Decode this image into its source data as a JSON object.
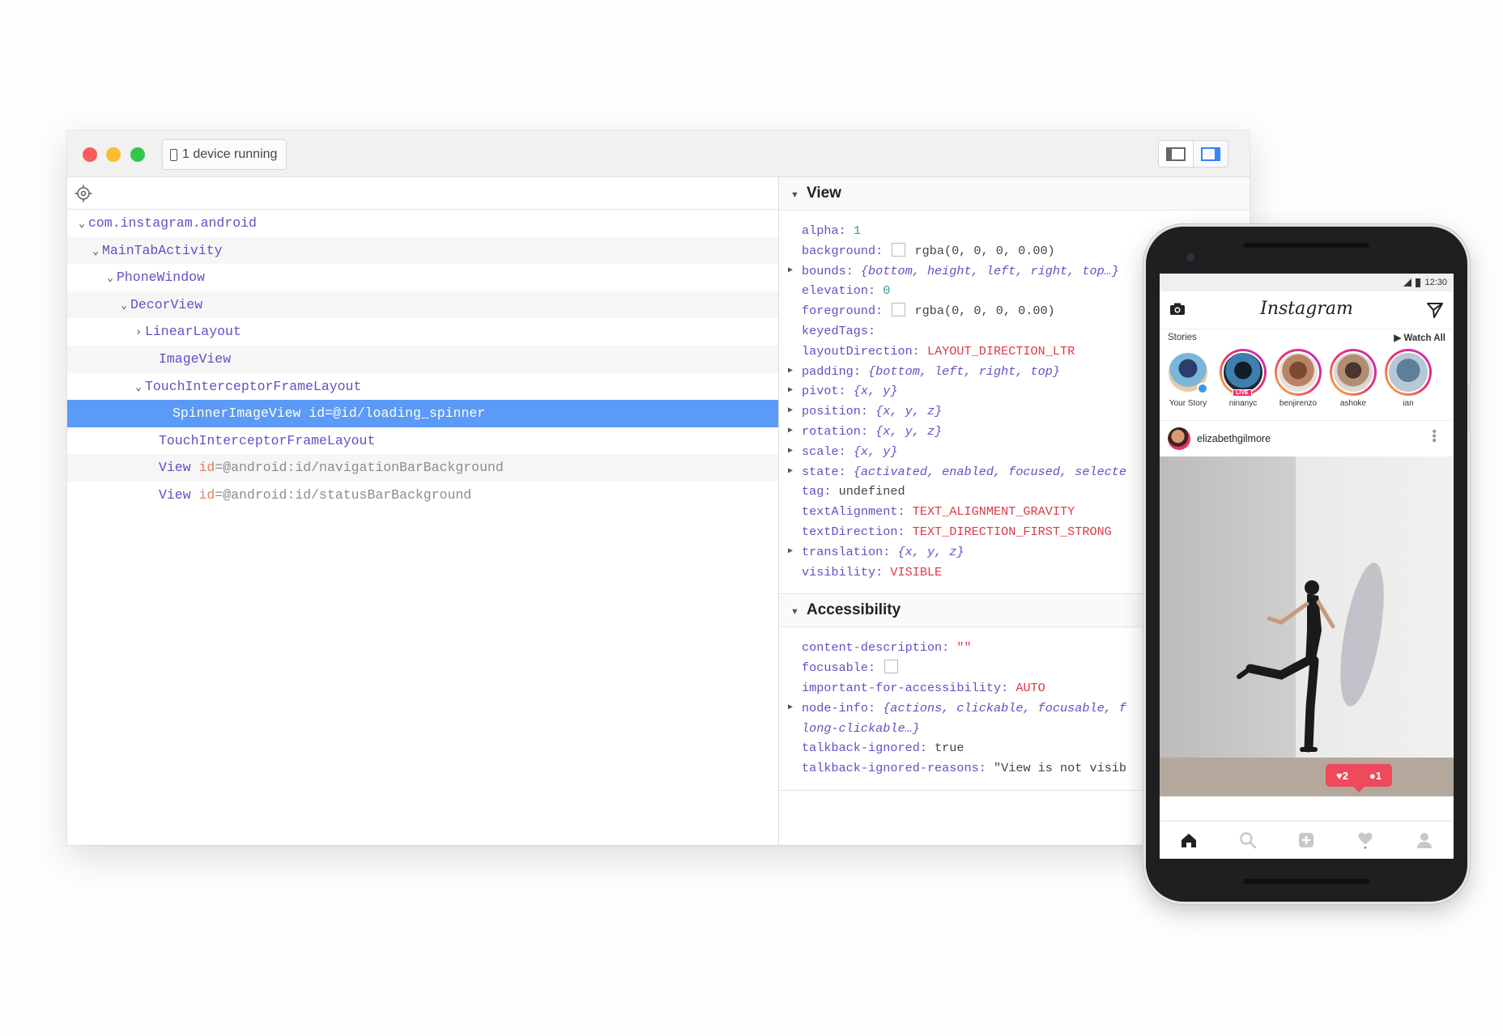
{
  "window": {
    "device_status": "1 device running"
  },
  "tree": {
    "rows": [
      {
        "label": "com.instagram.android",
        "chev": "⌄"
      },
      {
        "label": "MainTabActivity",
        "chev": "⌄"
      },
      {
        "label": "PhoneWindow",
        "chev": "⌄"
      },
      {
        "label": "DecorView",
        "chev": "⌄"
      },
      {
        "label": "LinearLayout",
        "chev": "›"
      },
      {
        "label": "ImageView",
        "chev": ""
      },
      {
        "label": "TouchInterceptorFrameLayout",
        "chev": "⌄"
      },
      {
        "label": "SpinnerImageView id=@id/loading_spinner",
        "chev": ""
      },
      {
        "label": "TouchInterceptorFrameLayout",
        "chev": ""
      },
      {
        "label": "View",
        "attr_key": "id",
        "attr_val": "=@android:id/navigationBarBackground",
        "chev": ""
      },
      {
        "label": "View",
        "attr_key": "id",
        "attr_val": "=@android:id/statusBarBackground",
        "chev": ""
      }
    ]
  },
  "view_section": {
    "title": "View",
    "props": [
      {
        "key": "alpha",
        "value": "1",
        "style": "num"
      },
      {
        "key": "background",
        "value": "rgba(0, 0, 0, 0.00)",
        "style": "plain",
        "swatch": true
      },
      {
        "key": "bounds",
        "value": "{bottom, height, left, right, top…}",
        "style": "it",
        "expandable": true
      },
      {
        "key": "elevation",
        "value": "0",
        "style": "num"
      },
      {
        "key": "foreground",
        "value": "rgba(0, 0, 0, 0.00)",
        "style": "plain",
        "swatch": true
      },
      {
        "key": "keyedTags",
        "value": "",
        "style": "plain"
      },
      {
        "key": "layoutDirection",
        "value": "LAYOUT_DIRECTION_LTR",
        "style": "red"
      },
      {
        "key": "padding",
        "value": "{bottom, left, right, top}",
        "style": "it",
        "expandable": true
      },
      {
        "key": "pivot",
        "value": "{x, y}",
        "style": "it",
        "expandable": true
      },
      {
        "key": "position",
        "value": "{x, y, z}",
        "style": "it",
        "expandable": true
      },
      {
        "key": "rotation",
        "value": "{x, y, z}",
        "style": "it",
        "expandable": true
      },
      {
        "key": "scale",
        "value": "{x, y}",
        "style": "it",
        "expandable": true
      },
      {
        "key": "state",
        "value": "{activated, enabled, focused, selecte",
        "style": "it",
        "expandable": true
      },
      {
        "key": "tag",
        "value": "undefined",
        "style": "plain"
      },
      {
        "key": "textAlignment",
        "value": "TEXT_ALIGNMENT_GRAVITY",
        "style": "red"
      },
      {
        "key": "textDirection",
        "value": "TEXT_DIRECTION_FIRST_STRONG",
        "style": "red"
      },
      {
        "key": "translation",
        "value": "{x, y, z}",
        "style": "it",
        "expandable": true
      },
      {
        "key": "visibility",
        "value": "VISIBLE",
        "style": "red"
      }
    ]
  },
  "accessibility_section": {
    "title": "Accessibility",
    "props": [
      {
        "key": "content-description",
        "value": "\"\"",
        "style": "red"
      },
      {
        "key": "focusable",
        "value": "",
        "style": "plain",
        "swatch": true
      },
      {
        "key": "important-for-accessibility",
        "value": "AUTO",
        "style": "red"
      },
      {
        "key": "node-info",
        "value": "{actions, clickable, focusable, f",
        "style": "it",
        "expandable": true
      },
      {
        "key": "",
        "value": "long-clickable…}",
        "style": "it",
        "continuation": true
      },
      {
        "key": "talkback-ignored",
        "value": "true",
        "style": "plain"
      },
      {
        "key": "talkback-ignored-reasons",
        "value": "\"View is not visib",
        "style": "plain"
      }
    ]
  },
  "phone": {
    "time": "12:30",
    "app_logo": "Instagram",
    "stories_label": "Stories",
    "watch_all": "▶ Watch All",
    "stories": [
      {
        "name": "Your Story",
        "kind": "own"
      },
      {
        "name": "ninanyc",
        "kind": "live",
        "live_label": "LIVE"
      },
      {
        "name": "benjirenzo",
        "kind": "ring"
      },
      {
        "name": "ashoke",
        "kind": "ring"
      },
      {
        "name": "ian",
        "kind": "ring"
      }
    ],
    "post_user": "elizabethgilmore",
    "likes": "2",
    "comments": "1"
  },
  "colors": {
    "selection": "#5b9af6",
    "tree_text": "#6a4cc6",
    "enum_value": "#dc3a4a",
    "number_value": "#2aa198",
    "instagram_gradient": "#e9336a"
  }
}
